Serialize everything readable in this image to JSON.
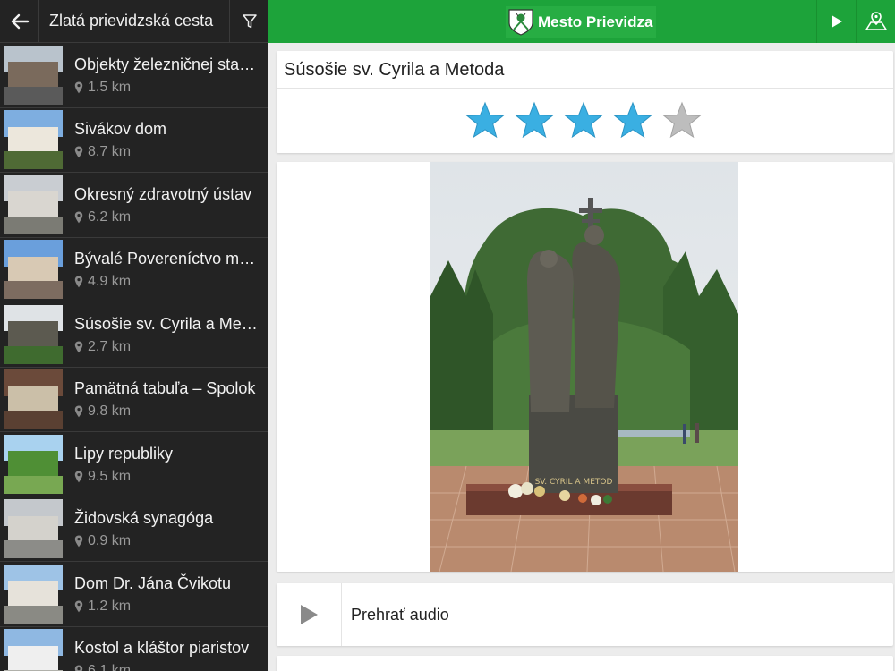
{
  "sidebar": {
    "title": "Zlatá prievidzská cesta",
    "items": [
      {
        "name": "Objekty železničnej stanice",
        "distance": "1.5 km",
        "colors": [
          "#b9c3cc",
          "#7a6a5c",
          "#5a5a5a"
        ]
      },
      {
        "name": "Sivákov dom",
        "distance": "8.7 km",
        "colors": [
          "#7eaee0",
          "#ece7dc",
          "#4f6a35"
        ]
      },
      {
        "name": "Okresný zdravotný ústav",
        "distance": "6.2 km",
        "colors": [
          "#c9cdd2",
          "#d9d6d0",
          "#7b7b74"
        ]
      },
      {
        "name": "Bývalé Povereníctvo mesta",
        "distance": "4.9 km",
        "colors": [
          "#6a9fdc",
          "#d8c9b4",
          "#7d6c60"
        ]
      },
      {
        "name": "Súsošie sv. Cyrila a Metoda",
        "distance": "2.7 km",
        "colors": [
          "#dfe3e6",
          "#5c5a50",
          "#3f6b2f"
        ]
      },
      {
        "name": "Pamätná tabuľa – Spolok",
        "distance": "9.8 km",
        "colors": [
          "#6b4a3a",
          "#cbbfa8",
          "#5a4032"
        ]
      },
      {
        "name": "Lipy republiky",
        "distance": "9.5 km",
        "colors": [
          "#a9d2ef",
          "#4f8f35",
          "#78a852"
        ]
      },
      {
        "name": "Židovská synagóga",
        "distance": "0.9 km",
        "colors": [
          "#c4c8cc",
          "#d4d2cc",
          "#8c8c88"
        ]
      },
      {
        "name": "Dom Dr. Jána Čvikotu",
        "distance": "1.2 km",
        "colors": [
          "#9ec3e6",
          "#e6e2da",
          "#8a8a84"
        ]
      },
      {
        "name": "Kostol a kláštor piaristov",
        "distance": "6.1 km",
        "colors": [
          "#8fb8e2",
          "#efefef",
          "#b0b0aa"
        ]
      }
    ]
  },
  "topbar": {
    "brand_name": "Mesto Prievidza",
    "accent": "#1da33a"
  },
  "detail": {
    "title": "Súsošie sv. Cyrila a Metoda",
    "rating": 4,
    "rating_max": 5,
    "star_color_on": "#3aafe2",
    "star_color_off": "#bdbdbd",
    "statue_inscription": "SV. CYRIL A METOD",
    "audio_label": "Prehrať audio"
  }
}
